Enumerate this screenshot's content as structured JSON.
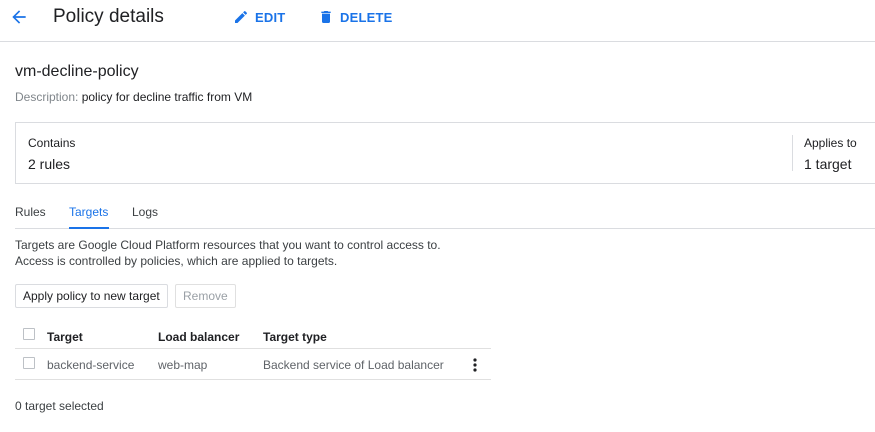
{
  "header": {
    "title": "Policy details",
    "back_icon": "arrow-back-icon",
    "edit_label": "EDIT",
    "edit_icon": "pencil-icon",
    "delete_label": "DELETE",
    "delete_icon": "trash-icon",
    "accent_color": "#1a73e8"
  },
  "policy": {
    "name": "vm-decline-policy",
    "description_label": "Description:",
    "description": "policy for decline traffic from VM"
  },
  "summary": {
    "contains_label": "Contains",
    "contains_value": "2 rules",
    "applies_label": "Applies to",
    "applies_value": "1 target"
  },
  "tabs": [
    {
      "label": "Rules",
      "active": false
    },
    {
      "label": "Targets",
      "active": true
    },
    {
      "label": "Logs",
      "active": false
    }
  ],
  "targets": {
    "info_line1": "Targets are Google Cloud Platform resources that you want to control access to.",
    "info_line2": "Access is controlled by policies, which are applied to targets.",
    "apply_button": "Apply policy to new target",
    "remove_button": "Remove",
    "table": {
      "columns": [
        "Target",
        "Load balancer",
        "Target type"
      ],
      "rows": [
        {
          "target": "backend-service",
          "load_balancer": "web-map",
          "target_type": "Backend service of Load balancer"
        }
      ]
    },
    "selected_text": "0 target selected"
  }
}
